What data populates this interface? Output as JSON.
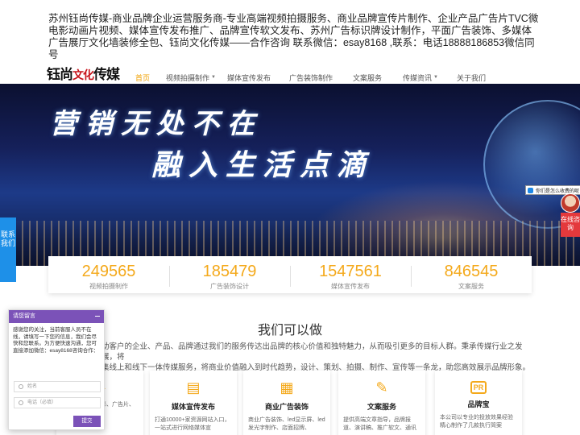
{
  "top_description": "苏州钰尚传媒-商业品牌企业运营服务商-专业高端视频拍摄服务、商业品牌宣传片制作、企业产品广告片TVC微电影动画片视频、媒体宣传发布推广、品牌宣传软文发布、苏州广告标识牌设计制作，平面广告装饰、多媒体广告展厅文化墙装修全包、钰尚文化传媒——合作咨询 联系微信：esay8168 ,联系：电话18888186853微信同号",
  "logo": {
    "part1": "钰尚",
    "part2": "文化",
    "part3": "传媒"
  },
  "nav": [
    {
      "label": "首页",
      "dropdown": false
    },
    {
      "label": "视频拍摄制作",
      "dropdown": true
    },
    {
      "label": "媒体宣传发布",
      "dropdown": false
    },
    {
      "label": "广告装饰制作",
      "dropdown": false
    },
    {
      "label": "文案服务",
      "dropdown": false
    },
    {
      "label": "传媒资讯",
      "dropdown": true
    },
    {
      "label": "关于我们",
      "dropdown": false
    }
  ],
  "banner": {
    "slogan_line1": "营销无处不在",
    "slogan_line2": "融入生活点滴"
  },
  "chat_tip": "你们是怎么收费的呢",
  "online_service": "在线咨询",
  "contact_tab": "联系我们",
  "stats": [
    {
      "value": "249565",
      "label": "视频拍摄制作"
    },
    {
      "value": "185479",
      "label": "广告装饰设计"
    },
    {
      "value": "1547561",
      "label": "媒体宣传发布"
    },
    {
      "value": "846545",
      "label": "文案服务"
    }
  ],
  "section": {
    "title": "我们可以做",
    "desc_line1": "助客户的企业、产品、品牌通过我们的服务传达出品牌的核心价值和独特魅力，从而吸引更多的目标人群。秉承传媒行业之发展，将",
    "desc_line2": "集线上和线下一体传媒服务，将商业价值融入到时代趋势，设计、策划、拍摄、制作、宣传等一条龙，助您高效展示品牌形象。"
  },
  "cards": [
    {
      "icon": "video-icon",
      "title": "",
      "desc": "业宣传片、微电影、广告片、视频广"
    },
    {
      "icon": "document-icon",
      "title": "媒体宣传发布",
      "desc": "打通10000+家资源网站入口，一站式进行网络媒体宣"
    },
    {
      "icon": "layout-icon",
      "title": "商业广告装饰",
      "desc": "商业广告装饰、led显示屏、led发光字制作、店面招牌、"
    },
    {
      "icon": "pencil-icon",
      "title": "文案服务",
      "desc": "提供高端文章指导，品牌报道、演讲稿、推广软文、通讯"
    },
    {
      "icon": "pr-icon",
      "title": "品牌宝",
      "desc": "本公司以专业的投放效果经验精心制作了几款执行简案"
    }
  ],
  "message_box": {
    "title": "请您留言",
    "text": "感谢您的关注，当前客服人员不在线，请填写一下您的信息，我们会尽快和您联系。为方便快速沟通，您可直接添加微信：esay8168咨询合作：",
    "name_placeholder": "姓名",
    "phone_placeholder": "电话（必填）",
    "submit_label": "提交"
  },
  "colors": {
    "accent": "#f4a91b",
    "chat_purple": "#7b52b8",
    "contact_blue": "#1e90e8",
    "online_red": "#e4393c"
  }
}
